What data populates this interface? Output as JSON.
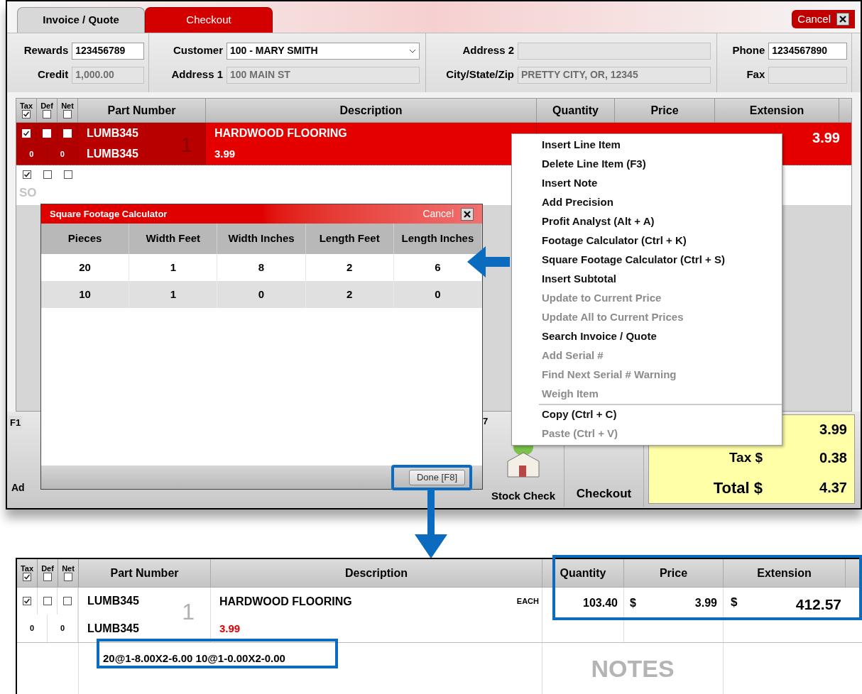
{
  "tabs": [
    {
      "label": "Invoice / Quote",
      "selected": true
    },
    {
      "label": "Checkout",
      "selected": false
    }
  ],
  "cancel_button": "Cancel",
  "field_groups": [
    [
      {
        "label": "Rewards",
        "value": "123456789",
        "kind": "input",
        "disabled": false
      },
      {
        "label": "Credit",
        "value": "1,000.00",
        "kind": "input",
        "disabled": true
      }
    ],
    [
      {
        "label": "Customer",
        "value": "100 - MARY SMITH",
        "kind": "select",
        "disabled": false
      },
      {
        "label": "Address 1",
        "value": "100 MAIN ST",
        "kind": "input",
        "disabled": true
      }
    ],
    [
      {
        "label": "Address 2",
        "kind": "input",
        "disabled": true
      },
      {
        "label": "City/State/Zip",
        "value": "PRETTY CITY, OR, 12345",
        "kind": "input",
        "disabled": true
      }
    ],
    [
      {
        "label": "Phone",
        "value": "1234567890",
        "kind": "input",
        "disabled": false
      },
      {
        "label": "Fax",
        "kind": "input",
        "disabled": true
      }
    ]
  ],
  "line_table": {
    "checks": [
      {
        "label": "Tax",
        "checked": true
      },
      {
        "label": "Def",
        "checked": false
      },
      {
        "label": "Net",
        "checked": false
      }
    ],
    "columns": [
      "Part Number",
      "Description",
      "Quantity",
      "Price",
      "Extension"
    ],
    "rows": [
      {
        "selected": true,
        "checks": [
          true,
          false,
          false
        ],
        "line_no": "1",
        "part_number": "LUMB345",
        "description": "HARDWOOD FLOORING",
        "counts": [
          "0",
          "0"
        ],
        "part_number_2": "LUMB345",
        "price_text": "3.99",
        "extension": "3.99"
      },
      {
        "selected": false,
        "checks": [
          true,
          false,
          false
        ],
        "note": "SO"
      }
    ]
  },
  "toolbar": [
    {
      "key": "F1",
      "label": "Ad"
    },
    {
      "key": "7",
      "label": "Stock Check"
    },
    {
      "label": "Checkout"
    }
  ],
  "totals": [
    {
      "value": "3.99"
    },
    {
      "label": "Tax $",
      "value": "0.38"
    },
    {
      "label": "Total $",
      "value": "4.37"
    }
  ],
  "context_menu": [
    [
      {
        "label": "Insert Line Item",
        "disabled": false
      },
      {
        "label": "Delete Line Item (F3)",
        "disabled": false
      },
      {
        "label": "Insert Note",
        "disabled": false
      },
      {
        "label": "Add Precision",
        "disabled": false
      },
      {
        "label": "Profit Analyst (Alt + A)",
        "disabled": false
      },
      {
        "label": "Footage Calculator (Ctrl + K)",
        "disabled": false
      },
      {
        "label": "Square Footage Calculator (Ctrl + S)",
        "disabled": false
      },
      {
        "label": "Insert Subtotal",
        "disabled": false
      },
      {
        "label": "Update to Current Price",
        "disabled": true
      },
      {
        "label": "Update All to Current Prices",
        "disabled": true
      },
      {
        "label": "Search Invoice / Quote",
        "disabled": false
      },
      {
        "label": "Add Serial #",
        "disabled": true
      },
      {
        "label": "Find Next Serial # Warning",
        "disabled": true
      },
      {
        "label": "Weigh Item",
        "disabled": true
      }
    ],
    [
      {
        "label": "Copy (Ctrl + C)",
        "disabled": false
      },
      {
        "label": "Paste (Ctrl + V)",
        "disabled": true
      }
    ]
  ],
  "calculator": {
    "title": "Square Footage Calculator",
    "cancel": "Cancel",
    "columns": [
      "Pieces",
      "Width Feet",
      "Width Inches",
      "Length Feet",
      "Length Inches"
    ],
    "rows": [
      [
        "20",
        "1",
        "8",
        "2",
        "6"
      ],
      [
        "10",
        "1",
        "0",
        "2",
        "0"
      ]
    ],
    "done_button": "Done [F8]"
  },
  "result_table": {
    "checks": [
      {
        "label": "Tax",
        "checked": true
      },
      {
        "label": "Def",
        "checked": false
      },
      {
        "label": "Net",
        "checked": false
      }
    ],
    "columns": [
      "Part Number",
      "Description",
      "Quantity",
      "Price",
      "Extension"
    ],
    "row": {
      "checks": [
        true,
        false,
        false
      ],
      "line_no": "1",
      "part_number": "LUMB345",
      "description": "HARDWOOD FLOORING",
      "unit": "EACH",
      "quantity": "103.40",
      "price_symbol": "$",
      "price": "3.99",
      "extension_symbol": "$",
      "extension": "412.57",
      "counts": [
        "0",
        "0"
      ],
      "part_number_2": "LUMB345",
      "price_text": "3.99",
      "note": "20@1-8.00X2-6.00 10@1-0.00X2-0.00",
      "notes_label": "NOTES"
    }
  }
}
